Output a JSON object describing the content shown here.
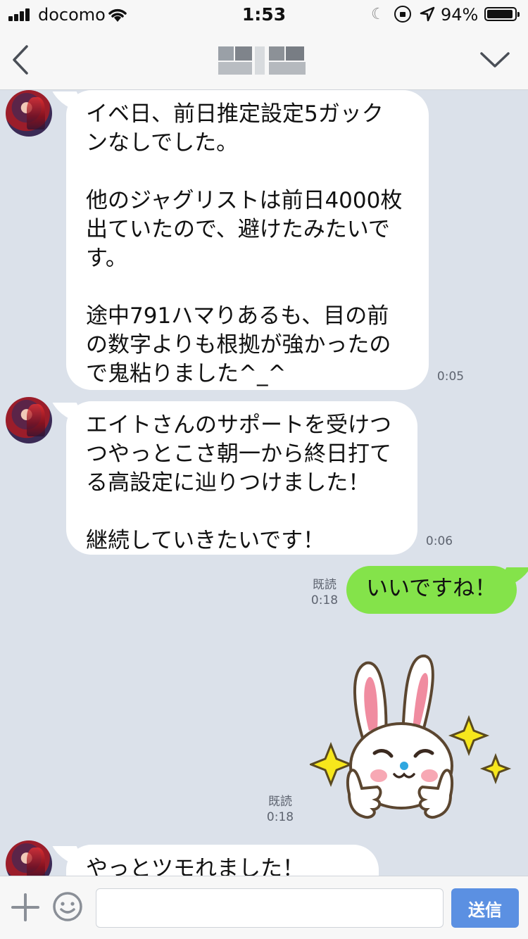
{
  "status_bar": {
    "carrier": "docomo",
    "time": "1:53",
    "battery_text": "94%",
    "battery_level": 0.94
  },
  "nav": {
    "title_redacted": true,
    "back_icon": "chevron-left-icon",
    "menu_icon": "chevron-down-icon"
  },
  "messages": [
    {
      "direction": "incoming",
      "text": "イベ日、前日推定設定5ガック\nンなしでした。\n\n他のジャグリストは前日4000枚\n出ていたので、避けたみたいで\nす。\n\n途中791ハマりあるも、目の前\nの数字よりも根拠が強かったの\nで鬼粘りました^_^",
      "time": "0:05"
    },
    {
      "direction": "incoming",
      "text": "エイトさんのサポートを受けつ\nつやっとこさ朝一から終日打て\nる高設定に辿りつけました！\n\n継続していきたいです！",
      "time": "0:06"
    },
    {
      "direction": "outgoing",
      "text": "いいですね！",
      "read": "既読",
      "time": "0:18"
    },
    {
      "direction": "outgoing",
      "type": "sticker",
      "sticker": "rabbit-thumbs-up",
      "read": "既読",
      "time": "0:18"
    },
    {
      "direction": "incoming",
      "text": "やっとツモれました！",
      "time": ""
    }
  ],
  "input_bar": {
    "placeholder": "",
    "send_label": "送信"
  },
  "colors": {
    "chat_background": "#dbe1ea",
    "outgoing_bubble": "#84e34a",
    "incoming_bubble": "#ffffff",
    "send_button": "#5b90e2"
  }
}
